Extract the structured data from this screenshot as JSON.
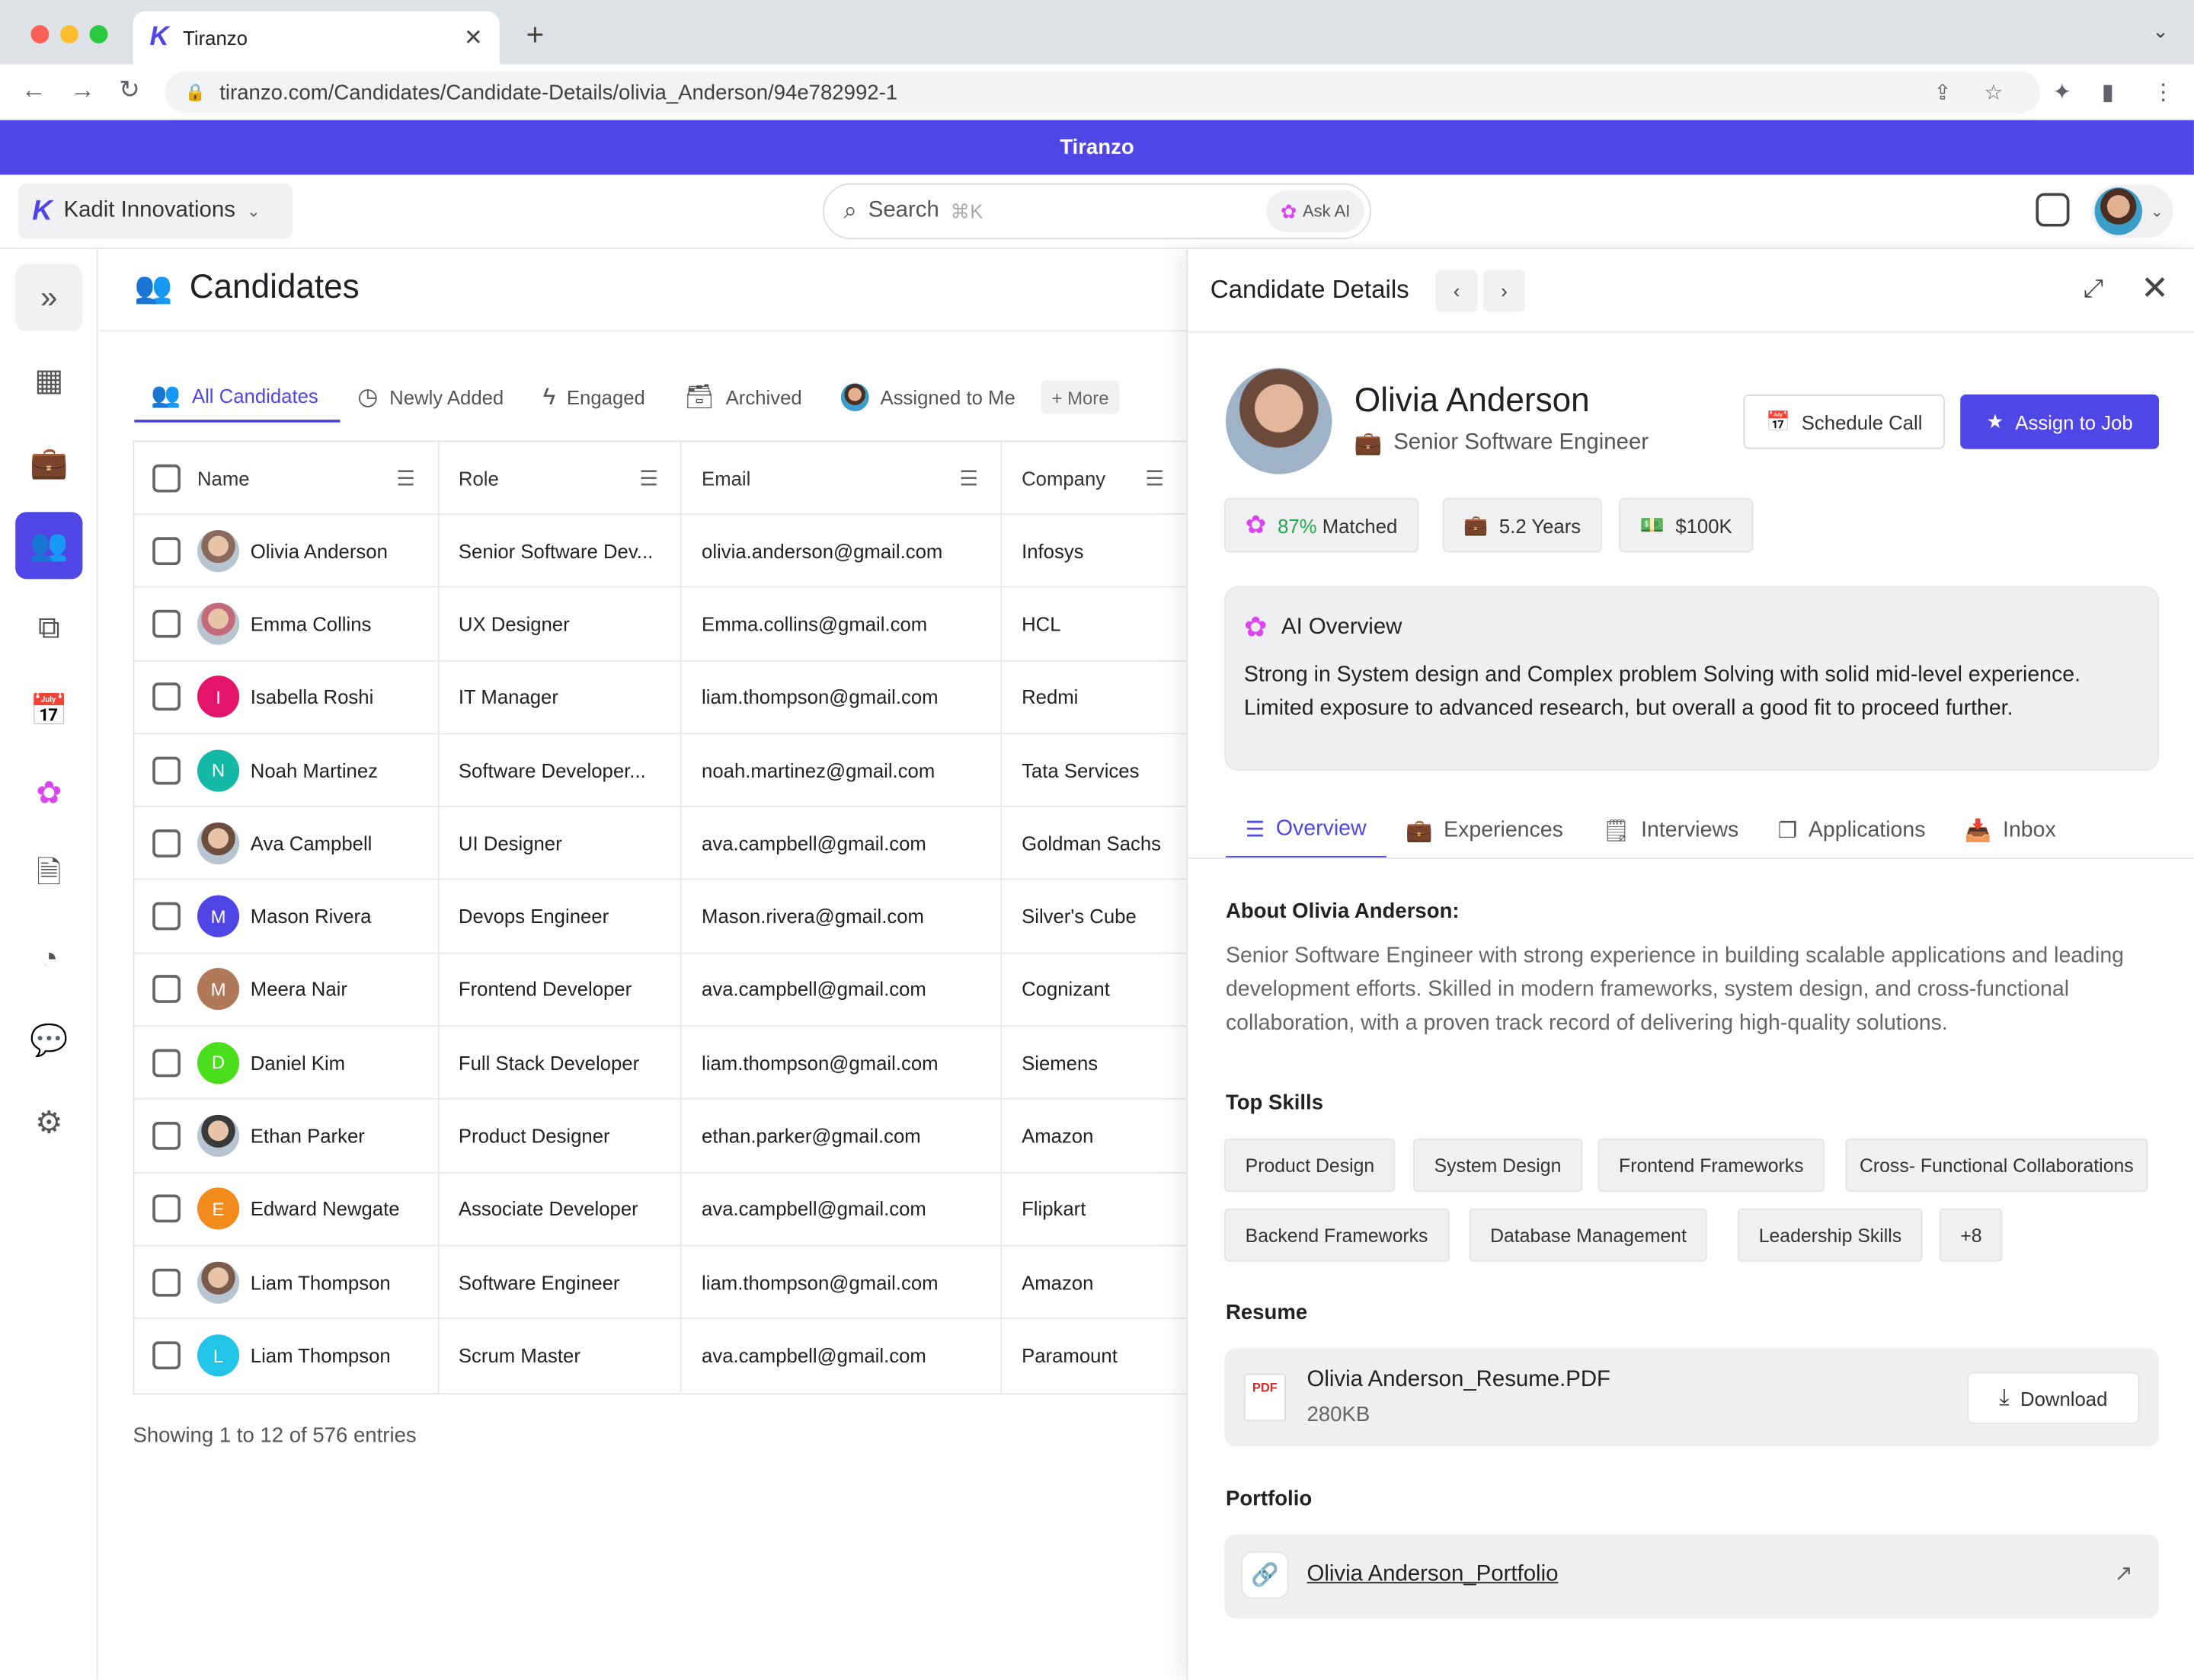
{
  "browser": {
    "tab_title": "Tiranzo",
    "url": "tiranzo.com/Candidates/Candidate-Details/olivia_Anderson/94e782992-1"
  },
  "banner": "Tiranzo",
  "header": {
    "org_name": "Kadit Innovations",
    "search_placeholder": "Search",
    "search_shortcut": "⌘K",
    "ask_ai": "Ask AI"
  },
  "page": {
    "title": "Candidates",
    "tabs": [
      {
        "label": "All Candidates",
        "icon": "users-icon",
        "active": true
      },
      {
        "label": "Newly Added",
        "icon": "clock-icon"
      },
      {
        "label": "Engaged",
        "icon": "bolt-icon"
      },
      {
        "label": "Archived",
        "icon": "archive-icon"
      },
      {
        "label": "Assigned to Me",
        "icon": "avatar-icon"
      }
    ],
    "more": "+ More",
    "columns": [
      "Name",
      "Role",
      "Email",
      "Company"
    ],
    "rows": [
      {
        "name": "Olivia Anderson",
        "role": "Senior Software Dev...",
        "email": "olivia.anderson@gmail.com",
        "company": "Infosys",
        "avatar": "photo",
        "color": "#8a6a5c",
        "initial": ""
      },
      {
        "name": "Emma Collins",
        "role": "UX Designer",
        "email": "Emma.collins@gmail.com",
        "company": "HCL",
        "avatar": "photo",
        "color": "#c26a7a",
        "initial": ""
      },
      {
        "name": "Isabella Roshi",
        "role": "IT Manager",
        "email": "liam.thompson@gmail.com",
        "company": "Redmi",
        "avatar": "initial",
        "color": "#e3156b",
        "initial": "I"
      },
      {
        "name": "Noah Martinez",
        "role": "Software Developer...",
        "email": "noah.martinez@gmail.com",
        "company": "Tata Services",
        "avatar": "initial",
        "color": "#14b8a6",
        "initial": "N"
      },
      {
        "name": "Ava Campbell",
        "role": "UI Designer",
        "email": "ava.campbell@gmail.com",
        "company": "Goldman Sachs",
        "avatar": "photo",
        "color": "#6b4e3d",
        "initial": ""
      },
      {
        "name": "Mason Rivera",
        "role": "Devops Engineer",
        "email": "Mason.rivera@gmail.com",
        "company": "Silver's Cube",
        "avatar": "initial",
        "color": "#4f46e5",
        "initial": "M"
      },
      {
        "name": "Meera Nair",
        "role": "Frontend Developer",
        "email": "ava.campbell@gmail.com",
        "company": "Cognizant",
        "avatar": "initial",
        "color": "#b07a5a",
        "initial": "M"
      },
      {
        "name": "Daniel Kim",
        "role": "Full Stack Developer",
        "email": "liam.thompson@gmail.com",
        "company": "Siemens",
        "avatar": "initial",
        "color": "#4ade1c",
        "initial": "D"
      },
      {
        "name": "Ethan Parker",
        "role": "Product Designer",
        "email": "ethan.parker@gmail.com",
        "company": "Amazon",
        "avatar": "photo",
        "color": "#3a3a3a",
        "initial": ""
      },
      {
        "name": "Edward Newgate",
        "role": "Associate Developer",
        "email": "ava.campbell@gmail.com",
        "company": "Flipkart",
        "avatar": "initial",
        "color": "#f28a1c",
        "initial": "E"
      },
      {
        "name": "Liam Thompson",
        "role": "Software Engineer",
        "email": "liam.thompson@gmail.com",
        "company": "Amazon",
        "avatar": "photo",
        "color": "#7a5a4a",
        "initial": ""
      },
      {
        "name": "Liam Thompson",
        "role": "Scrum Master",
        "email": "ava.campbell@gmail.com",
        "company": "Paramount",
        "avatar": "initial",
        "color": "#22c5e8",
        "initial": "L"
      }
    ],
    "footer": "Showing 1 to 12 of 576 entries"
  },
  "panel": {
    "title": "Candidate Details",
    "name": "Olivia Anderson",
    "role": "Senior Software Engineer",
    "schedule_call": "Schedule Call",
    "assign_to_job": "Assign to Job",
    "match_percent": "87%",
    "match_label": "Matched",
    "experience": "5.2 Years",
    "salary": "$100K",
    "ai_title": "AI Overview",
    "ai_text": "Strong in System design and Complex problem Solving with solid mid-level experience. Limited exposure to advanced research, but overall a good fit to proceed further.",
    "tabs": [
      "Overview",
      "Experiences",
      "Interviews",
      "Applications",
      "Inbox"
    ],
    "about_title": "About Olivia Anderson:",
    "about_text": "Senior Software Engineer with strong experience in building scalable applications and leading development efforts. Skilled in modern frameworks, system design, and cross-functional collaboration, with a proven track record of delivering high-quality solutions.",
    "skills_title": "Top Skills",
    "skills": [
      "Product Design",
      "System Design",
      "Frontend Frameworks",
      "Cross- Functional Collaborations",
      "Backend Frameworks",
      "Database Management",
      "Leadership Skills",
      "+8"
    ],
    "resume_title": "Resume",
    "resume_file": "Olivia Anderson_Resume.PDF",
    "resume_size": "280KB",
    "download": "Download",
    "portfolio_title": "Portfolio",
    "portfolio_link": "Olivia Anderson_Portfolio"
  },
  "colors": {
    "accent": "#4f46e5",
    "match": "#1faa4a"
  }
}
